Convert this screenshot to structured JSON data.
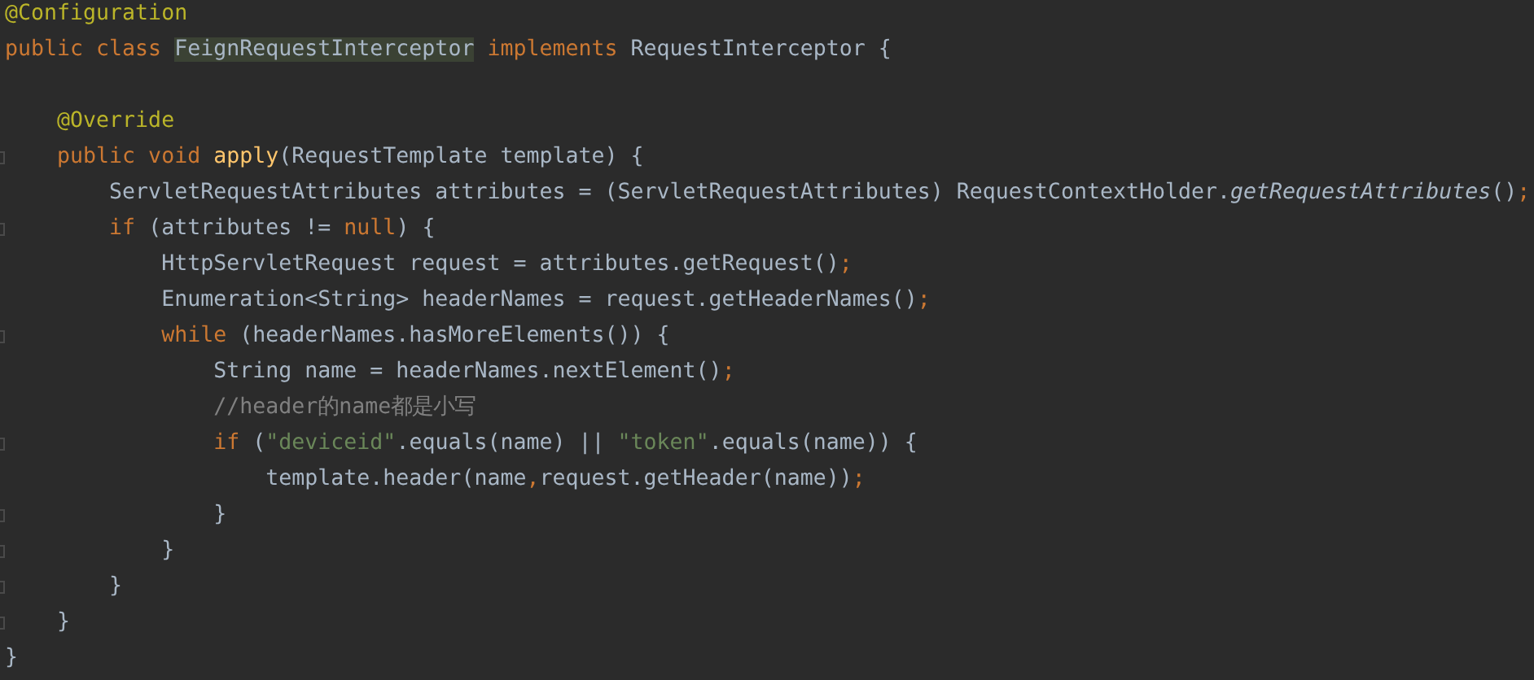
{
  "editor": {
    "lines": [
      {
        "fold": false,
        "tokens": [
          {
            "text": "@Configuration",
            "kind": "annotation"
          }
        ]
      },
      {
        "fold": false,
        "tokens": [
          {
            "text": "public class ",
            "kind": "keyword"
          },
          {
            "text": "FeignRequestInterceptor",
            "kind": "highlight"
          },
          {
            "text": " implements ",
            "kind": "keyword"
          },
          {
            "text": "RequestInterceptor {",
            "kind": "plain"
          }
        ]
      },
      {
        "fold": false
      },
      {
        "fold": false,
        "tokens": [
          {
            "text": "    @Override",
            "kind": "annotation"
          }
        ]
      },
      {
        "fold": true,
        "tokens": [
          {
            "text": "    public void ",
            "kind": "keyword"
          },
          {
            "text": "apply",
            "kind": "method"
          },
          {
            "text": "(RequestTemplate template) {",
            "kind": "plain"
          }
        ]
      },
      {
        "fold": false,
        "tokens": [
          {
            "text": "        ServletRequestAttributes attributes = (ServletRequestAttributes) RequestContextHolder.",
            "kind": "plain"
          },
          {
            "text": "getRequestAttributes",
            "kind": "static"
          },
          {
            "text": "()",
            "kind": "plain"
          },
          {
            "text": ";",
            "kind": "keyword"
          }
        ]
      },
      {
        "fold": true,
        "tokens": [
          {
            "text": "        if ",
            "kind": "keyword"
          },
          {
            "text": "(attributes != ",
            "kind": "plain"
          },
          {
            "text": "null",
            "kind": "keyword"
          },
          {
            "text": ") {",
            "kind": "plain"
          }
        ]
      },
      {
        "fold": false,
        "tokens": [
          {
            "text": "            HttpServletRequest request = attributes.getRequest()",
            "kind": "plain"
          },
          {
            "text": ";",
            "kind": "keyword"
          }
        ]
      },
      {
        "fold": false,
        "tokens": [
          {
            "text": "            Enumeration<String> headerNames = request.getHeaderNames()",
            "kind": "plain"
          },
          {
            "text": ";",
            "kind": "keyword"
          }
        ]
      },
      {
        "fold": true,
        "tokens": [
          {
            "text": "            while ",
            "kind": "keyword"
          },
          {
            "text": "(headerNames.hasMoreElements()) {",
            "kind": "plain"
          }
        ]
      },
      {
        "fold": false,
        "tokens": [
          {
            "text": "                String name = headerNames.nextElement()",
            "kind": "plain"
          },
          {
            "text": ";",
            "kind": "keyword"
          }
        ]
      },
      {
        "fold": false,
        "tokens": [
          {
            "text": "                //header的name都是小写",
            "kind": "comment"
          }
        ]
      },
      {
        "fold": true,
        "tokens": [
          {
            "text": "                if ",
            "kind": "keyword"
          },
          {
            "text": "(",
            "kind": "plain"
          },
          {
            "text": "\"deviceid\"",
            "kind": "string"
          },
          {
            "text": ".equals(name) || ",
            "kind": "plain"
          },
          {
            "text": "\"token\"",
            "kind": "string"
          },
          {
            "text": ".equals(name)) {",
            "kind": "plain"
          }
        ]
      },
      {
        "fold": false,
        "tokens": [
          {
            "text": "                    template.header(name",
            "kind": "plain"
          },
          {
            "text": ",",
            "kind": "keyword"
          },
          {
            "text": "request.getHeader(name))",
            "kind": "plain"
          },
          {
            "text": ";",
            "kind": "keyword"
          }
        ]
      },
      {
        "fold": true,
        "tokens": [
          {
            "text": "                }",
            "kind": "plain"
          }
        ]
      },
      {
        "fold": true,
        "tokens": [
          {
            "text": "            }",
            "kind": "plain"
          }
        ]
      },
      {
        "fold": true,
        "tokens": [
          {
            "text": "        }",
            "kind": "plain"
          }
        ]
      },
      {
        "fold": true,
        "tokens": [
          {
            "text": "    }",
            "kind": "plain"
          }
        ]
      },
      {
        "fold": false,
        "tokens": [
          {
            "text": "}",
            "kind": "plain"
          }
        ]
      }
    ]
  }
}
